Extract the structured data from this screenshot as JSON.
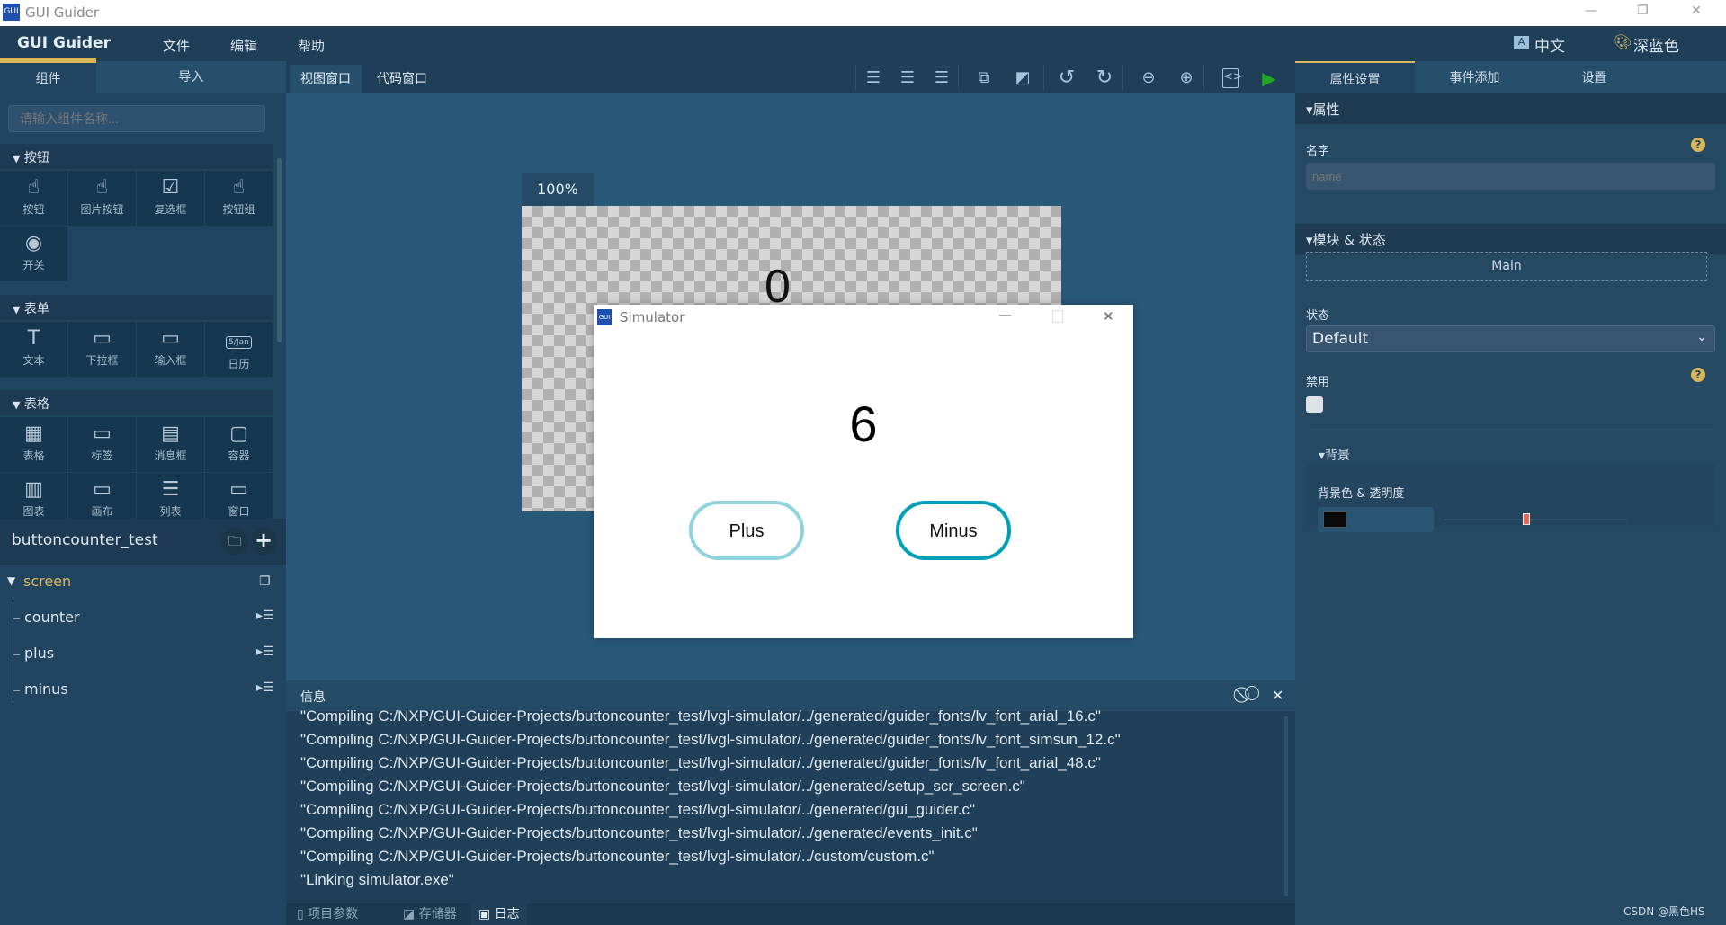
{
  "window": {
    "title": "GUI Guider",
    "min": "—",
    "restore": "❐",
    "close": "✕"
  },
  "menu": {
    "brand": "GUI Guider",
    "items": [
      "文件",
      "编辑",
      "帮助"
    ],
    "language": "中文",
    "theme": "深蓝色"
  },
  "left": {
    "tabs": [
      "组件",
      "导入"
    ],
    "search_placeholder": "请输入组件名称...",
    "sections": [
      {
        "title": "按钮",
        "items": [
          {
            "label": "按钮",
            "icon": "button-icon"
          },
          {
            "label": "图片按钮",
            "icon": "image-button-icon"
          },
          {
            "label": "复选框",
            "icon": "checkbox-icon"
          },
          {
            "label": "按钮组",
            "icon": "button-group-icon"
          },
          {
            "label": "开关",
            "icon": "switch-icon"
          }
        ]
      },
      {
        "title": "表单",
        "items": [
          {
            "label": "文本",
            "icon": "text-icon"
          },
          {
            "label": "下拉框",
            "icon": "dropdown-icon"
          },
          {
            "label": "输入框",
            "icon": "textarea-icon"
          },
          {
            "label": "日历",
            "icon": "calendar-icon"
          }
        ]
      },
      {
        "title": "表格",
        "items": [
          {
            "label": "表格",
            "icon": "table-icon"
          },
          {
            "label": "标签",
            "icon": "tabview-icon"
          },
          {
            "label": "消息框",
            "icon": "msgbox-icon"
          },
          {
            "label": "容器",
            "icon": "container-icon"
          },
          {
            "label": "图表",
            "icon": "chart-icon"
          },
          {
            "label": "画布",
            "icon": "canvas-icon"
          },
          {
            "label": "列表",
            "icon": "list-icon"
          },
          {
            "label": "窗口",
            "icon": "window-icon"
          }
        ]
      }
    ],
    "calendar_icon_text": "5/Jan",
    "project": {
      "name": "buttoncounter_test",
      "screen": "screen",
      "widgets": [
        "counter",
        "plus",
        "minus"
      ]
    }
  },
  "center": {
    "tabs": [
      "视图窗口",
      "代码窗口"
    ],
    "zoom": "100%",
    "design_counter": "0"
  },
  "simulator": {
    "title": "Simulator",
    "counter": "6",
    "plus": "Plus",
    "minus": "Minus",
    "plus_border": "#8fd3e0",
    "minus_border": "#00a0b8"
  },
  "info": {
    "title": "信息",
    "lines": [
      "\"Compiling C:/NXP/GUI-Guider-Projects/buttoncounter_test/lvgl-simulator/../generated/guider_fonts/lv_font_arial_16.c\"",
      "\"Compiling C:/NXP/GUI-Guider-Projects/buttoncounter_test/lvgl-simulator/../generated/guider_fonts/lv_font_simsun_12.c\"",
      "\"Compiling C:/NXP/GUI-Guider-Projects/buttoncounter_test/lvgl-simulator/../generated/guider_fonts/lv_font_arial_48.c\"",
      "\"Compiling C:/NXP/GUI-Guider-Projects/buttoncounter_test/lvgl-simulator/../generated/setup_scr_screen.c\"",
      "\"Compiling C:/NXP/GUI-Guider-Projects/buttoncounter_test/lvgl-simulator/../generated/gui_guider.c\"",
      "\"Compiling C:/NXP/GUI-Guider-Projects/buttoncounter_test/lvgl-simulator/../generated/events_init.c\"",
      "\"Compiling C:/NXP/GUI-Guider-Projects/buttoncounter_test/lvgl-simulator/../custom/custom.c\"",
      "\"Linking simulator.exe\""
    ],
    "bottom_tabs": [
      "项目参数",
      "存储器",
      "日志"
    ]
  },
  "right": {
    "tabs": [
      "属性设置",
      "事件添加",
      "设置"
    ],
    "prop_section": "▾属性",
    "name_label": "名字",
    "name_placeholder": "name",
    "module_section": "▾模块 & 状态",
    "module": "Main",
    "state_label": "状态",
    "state_value": "Default",
    "disabled_label": "禁用",
    "bg_section": "▾背景",
    "bg_label": "背景色 & 透明度",
    "bg_color": "#0a0a0a",
    "opacity_percent": 45
  },
  "watermark": "CSDN @黑色HS",
  "colors": {
    "accent": "#d9b85c",
    "run": "#22a822"
  }
}
